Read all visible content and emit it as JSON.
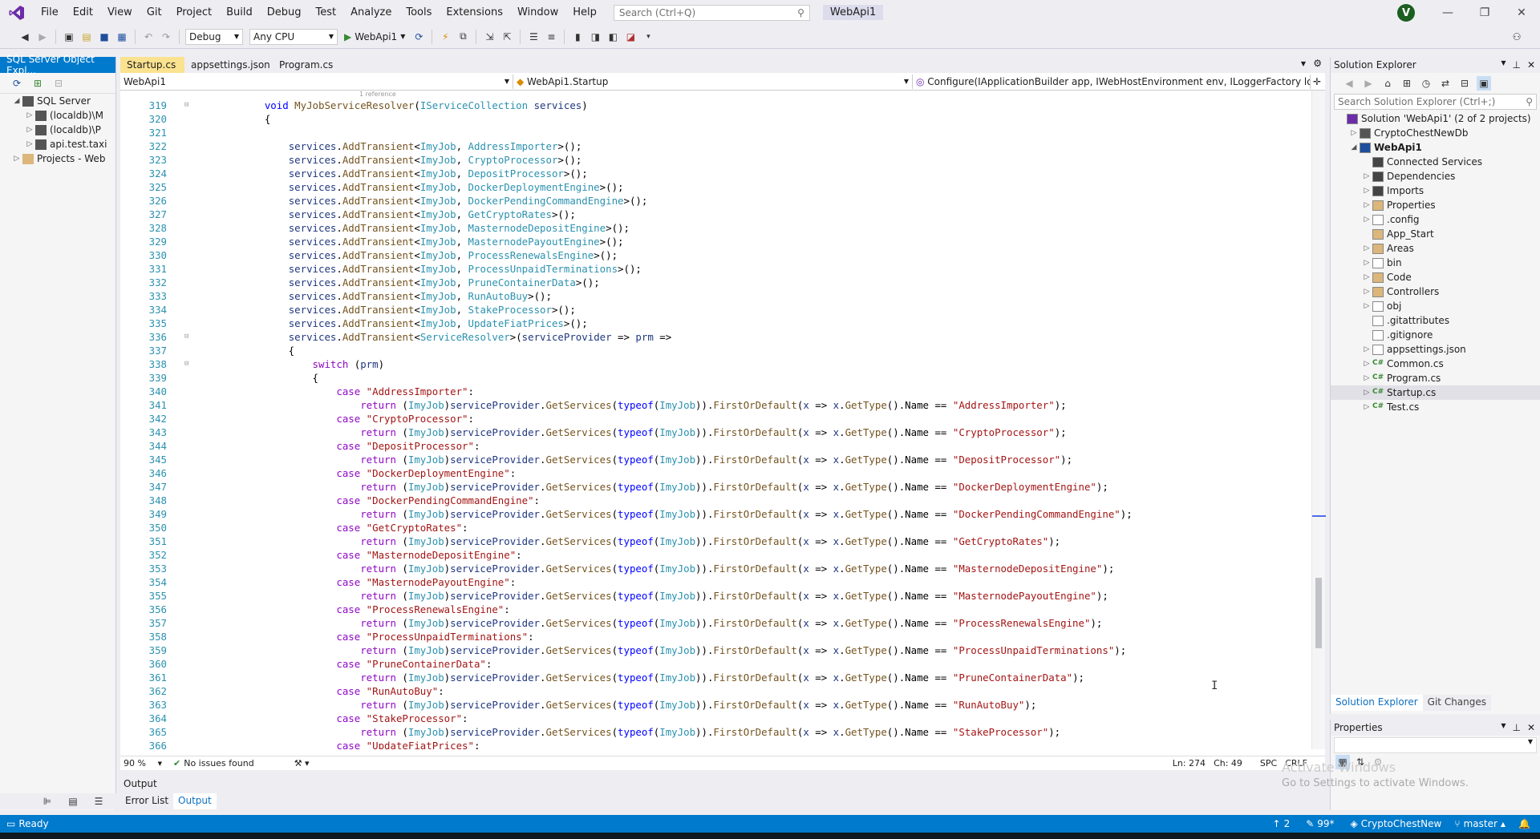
{
  "menu": [
    "File",
    "Edit",
    "View",
    "Git",
    "Project",
    "Build",
    "Debug",
    "Test",
    "Analyze",
    "Tools",
    "Extensions",
    "Window",
    "Help"
  ],
  "search": {
    "placeholder": "Search (Ctrl+Q)"
  },
  "solution_title": "WebApi1",
  "avatar_letter": "V",
  "toolbar": {
    "config": "Debug",
    "platform": "Any CPU",
    "run_target": "WebApi1"
  },
  "left_panel": {
    "title": "SQL Server Object Expl...",
    "tree": [
      {
        "label": "SQL Server",
        "level": 0,
        "arrow": "◢"
      },
      {
        "label": "(localdb)\\M",
        "level": 1,
        "arrow": "▷"
      },
      {
        "label": "(localdb)\\P",
        "level": 1,
        "arrow": "▷"
      },
      {
        "label": "api.test.taxi",
        "level": 1,
        "arrow": "▷"
      },
      {
        "label": "Projects - Web",
        "level": 0,
        "arrow": "▷"
      }
    ]
  },
  "doc_tabs": [
    {
      "label": "Startup.cs",
      "active": true
    },
    {
      "label": "appsettings.json",
      "active": false
    },
    {
      "label": "Program.cs",
      "active": false
    }
  ],
  "nav": {
    "project": "WebApi1",
    "class": "WebApi1.Startup",
    "member": "Configure(IApplicationBuilder app, IWebHostEnvironment env, ILoggerFactory loggerF"
  },
  "codelens": "1 reference",
  "code": {
    "method_name": "MyJobServiceResolver",
    "param_type": "IServiceCollection",
    "param_name": "services",
    "jobs": [
      "AddressImporter",
      "CryptoProcessor",
      "DepositProcessor",
      "DockerDeploymentEngine",
      "DockerPendingCommandEngine",
      "GetCryptoRates",
      "MasternodeDepositEngine",
      "MasternodePayoutEngine",
      "ProcessRenewalsEngine",
      "ProcessUnpaidTerminations",
      "PruneContainerData",
      "RunAutoBuy",
      "StakeProcessor",
      "UpdateFiatPrices"
    ],
    "resolver_line": "services.AddTransient<ServiceResolver>(serviceProvider => prm =>",
    "switch_line": "switch (prm)"
  },
  "editor_status": {
    "zoom": "90 %",
    "issues": "No issues found",
    "line": "Ln: 274",
    "col": "Ch: 49",
    "spc": "SPC",
    "crlf": "CRLF"
  },
  "solution_explorer": {
    "title": "Solution Explorer",
    "search_placeholder": "Search Solution Explorer (Ctrl+;)",
    "items": [
      {
        "label": "Solution 'WebApi1' (2 of 2 projects)",
        "level": 0,
        "arrow": "",
        "icon": "solution-icon",
        "bold": false
      },
      {
        "label": "CryptoChestNewDb",
        "level": 1,
        "arrow": "▷",
        "icon": "db-project-icon",
        "bold": false
      },
      {
        "label": "WebApi1",
        "level": 1,
        "arrow": "◢",
        "icon": "web-project-icon",
        "bold": true
      },
      {
        "label": "Connected Services",
        "level": 2,
        "arrow": "",
        "icon": "connected-services-icon",
        "bold": false
      },
      {
        "label": "Dependencies",
        "level": 2,
        "arrow": "▷",
        "icon": "dependencies-icon",
        "bold": false
      },
      {
        "label": "Imports",
        "level": 2,
        "arrow": "▷",
        "icon": "imports-icon",
        "bold": false
      },
      {
        "label": "Properties",
        "level": 2,
        "arrow": "▷",
        "icon": "properties-folder-icon",
        "bold": false
      },
      {
        "label": ".config",
        "level": 2,
        "arrow": "▷",
        "icon": "folder-outline-icon",
        "bold": false
      },
      {
        "label": "App_Start",
        "level": 2,
        "arrow": "",
        "icon": "folder-icon",
        "bold": false
      },
      {
        "label": "Areas",
        "level": 2,
        "arrow": "▷",
        "icon": "folder-icon",
        "bold": false
      },
      {
        "label": "bin",
        "level": 2,
        "arrow": "▷",
        "icon": "folder-outline-icon",
        "bold": false
      },
      {
        "label": "Code",
        "level": 2,
        "arrow": "▷",
        "icon": "folder-icon",
        "bold": false
      },
      {
        "label": "Controllers",
        "level": 2,
        "arrow": "▷",
        "icon": "folder-icon",
        "bold": false
      },
      {
        "label": "obj",
        "level": 2,
        "arrow": "▷",
        "icon": "folder-outline-icon",
        "bold": false
      },
      {
        "label": ".gitattributes",
        "level": 2,
        "arrow": "",
        "icon": "file-icon",
        "bold": false
      },
      {
        "label": ".gitignore",
        "level": 2,
        "arrow": "",
        "icon": "file-icon",
        "bold": false
      },
      {
        "label": "appsettings.json",
        "level": 2,
        "arrow": "▷",
        "icon": "json-file-icon",
        "bold": false
      },
      {
        "label": "Common.cs",
        "level": 2,
        "arrow": "▷",
        "icon": "csharp-file-icon",
        "bold": false
      },
      {
        "label": "Program.cs",
        "level": 2,
        "arrow": "▷",
        "icon": "csharp-file-icon",
        "bold": false
      },
      {
        "label": "Startup.cs",
        "level": 2,
        "arrow": "▷",
        "icon": "csharp-file-icon",
        "bold": false,
        "selected": true
      },
      {
        "label": "Test.cs",
        "level": 2,
        "arrow": "▷",
        "icon": "csharp-file-icon",
        "bold": false
      }
    ],
    "tabs": [
      "Solution Explorer",
      "Git Changes"
    ]
  },
  "properties": {
    "title": "Properties"
  },
  "activate": {
    "line1": "Activate Windows",
    "line2": "Go to Settings to activate Windows."
  },
  "output": {
    "title": "Output",
    "tabs": [
      "Error List",
      "Output"
    ]
  },
  "status": {
    "ready": "Ready",
    "up_count": "2",
    "pencil_count": "99*",
    "repo": "CryptoChestNew",
    "branch": "master"
  },
  "colors": {
    "accent": "#007acc",
    "active_tab": "#fbe28f",
    "keyword": "#0000ff",
    "type": "#2b91af",
    "string": "#a31515"
  }
}
